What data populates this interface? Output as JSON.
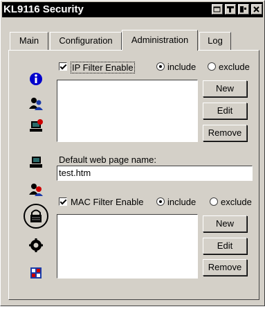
{
  "window": {
    "title": "KL9116 Security"
  },
  "tabs": [
    {
      "label": "Main"
    },
    {
      "label": "Configuration"
    },
    {
      "label": "Administration",
      "active": true
    },
    {
      "label": "Log"
    }
  ],
  "sidebar": {
    "icons": [
      "info-icon",
      "users-icon",
      "computer-security-icon",
      "computer-icon",
      "user-security-icon",
      "lock-icon",
      "gear-icon",
      "panel-icon"
    ],
    "selected": "lock-icon"
  },
  "ip_filter": {
    "label": "IP Filter Enable",
    "checked": true,
    "include_label": "include",
    "exclude_label": "exclude",
    "mode": "include",
    "buttons": {
      "new": "New",
      "edit": "Edit",
      "remove": "Remove"
    }
  },
  "default_page": {
    "label": "Default web page name:",
    "value": "test.htm"
  },
  "mac_filter": {
    "label": "MAC Filter Enable",
    "checked": true,
    "include_label": "include",
    "exclude_label": "exclude",
    "mode": "include",
    "buttons": {
      "new": "New",
      "edit": "Edit",
      "remove": "Remove"
    }
  },
  "colors": {
    "face": "#d4d0c8",
    "titlebar": "#000000",
    "info_blue": "#0000cc",
    "alert_red": "#cc0000"
  }
}
